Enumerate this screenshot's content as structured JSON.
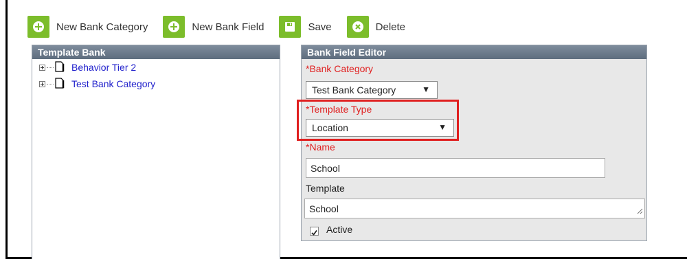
{
  "toolbar": {
    "new_bank_category": "New Bank Category",
    "new_bank_field": "New Bank Field",
    "save": "Save",
    "delete": "Delete"
  },
  "template_bank": {
    "header": "Template Bank",
    "items": [
      {
        "label": "Behavior Tier 2"
      },
      {
        "label": "Test Bank Category"
      }
    ]
  },
  "editor": {
    "header": "Bank Field Editor",
    "bank_category": {
      "required_mark": "*",
      "label": "Bank Category",
      "value": "Test Bank Category"
    },
    "template_type": {
      "required_mark": "*",
      "label": "Template Type",
      "value": "Location"
    },
    "name": {
      "required_mark": "*",
      "label": "Name",
      "value": "School"
    },
    "template": {
      "label": "Template",
      "value": "School"
    },
    "active": {
      "label": "Active",
      "checked": true
    }
  },
  "colors": {
    "accent_green": "#7cbd2b",
    "required_red": "#e02020",
    "link_blue": "#2222cc",
    "header_gray": "#6b7a8b"
  }
}
